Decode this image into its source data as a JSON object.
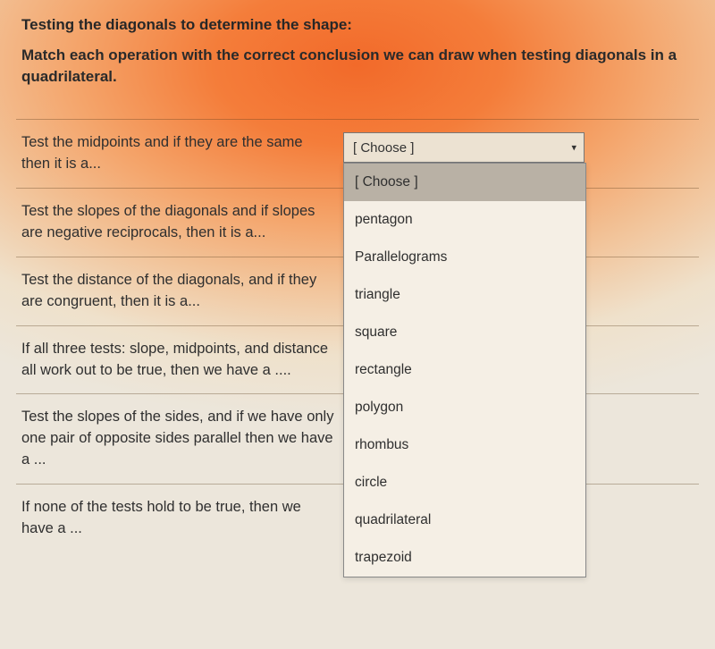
{
  "heading": "Testing the diagonals to determine the shape:",
  "instructions": "Match each operation with the correct conclusion we can draw when testing diagonals in a quadrilateral.",
  "select_placeholder": "[ Choose ]",
  "questions": [
    {
      "prompt": "Test the midpoints and if they are the same then it is a..."
    },
    {
      "prompt": "Test the slopes of the diagonals and if slopes are negative reciprocals, then it is a..."
    },
    {
      "prompt": "Test the distance of the diagonals, and if they are congruent, then it is a..."
    },
    {
      "prompt": "If all three tests: slope, midpoints, and distance all work out to be true, then we have a ...."
    },
    {
      "prompt": "Test the slopes of the sides, and if we have only one pair of opposite sides parallel then we have a ..."
    },
    {
      "prompt": "If none of the tests hold to be true, then we have a ..."
    }
  ],
  "dropdown_options": [
    "[ Choose ]",
    "pentagon",
    "Parallelograms",
    "triangle",
    "square",
    "rectangle",
    "polygon",
    "rhombus",
    "circle",
    "quadrilateral",
    "trapezoid"
  ],
  "open_dropdown_index": 0
}
